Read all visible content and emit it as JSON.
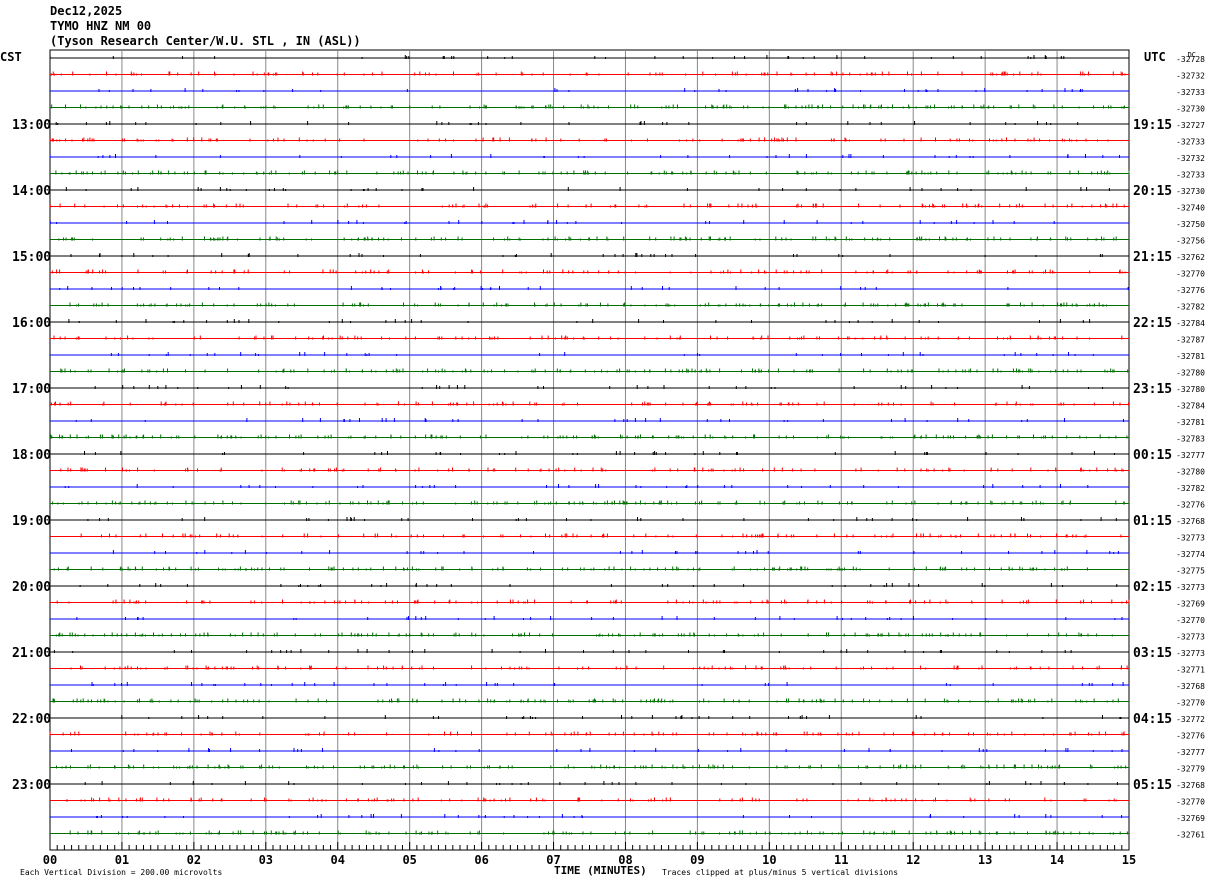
{
  "header": {
    "date": "Dec12,2025",
    "station": "TYMO HNZ NM 00",
    "location": "(Tyson Research Center/W.U. STL , IN (ASL))"
  },
  "chart_data": {
    "type": "line",
    "title": "TYMO HNZ NM 00 helicorder",
    "xlabel": "TIME (MINUTES)",
    "x_range": [
      0,
      15
    ],
    "x_ticks": [
      "00",
      "01",
      "02",
      "03",
      "04",
      "05",
      "06",
      "07",
      "08",
      "09",
      "10",
      "11",
      "12",
      "13",
      "14",
      "15"
    ],
    "left_axis_label": "CST",
    "right_axis_label": "UTC",
    "dc_label": "DC",
    "left_time_labels": [
      {
        "row": 4,
        "text": "13:00"
      },
      {
        "row": 8,
        "text": "14:00"
      },
      {
        "row": 12,
        "text": "15:00"
      },
      {
        "row": 16,
        "text": "16:00"
      },
      {
        "row": 20,
        "text": "17:00"
      },
      {
        "row": 24,
        "text": "18:00"
      },
      {
        "row": 28,
        "text": "19:00"
      },
      {
        "row": 32,
        "text": "20:00"
      },
      {
        "row": 36,
        "text": "21:00"
      },
      {
        "row": 40,
        "text": "22:00"
      },
      {
        "row": 44,
        "text": "23:00"
      }
    ],
    "right_time_labels": [
      {
        "row": 4,
        "text": "19:15"
      },
      {
        "row": 8,
        "text": "20:15"
      },
      {
        "row": 12,
        "text": "21:15"
      },
      {
        "row": 16,
        "text": "22:15"
      },
      {
        "row": 20,
        "text": "23:15"
      },
      {
        "row": 24,
        "text": "00:15"
      },
      {
        "row": 28,
        "text": "01:15"
      },
      {
        "row": 32,
        "text": "02:15"
      },
      {
        "row": 36,
        "text": "03:15"
      },
      {
        "row": 40,
        "text": "04:15"
      },
      {
        "row": 44,
        "text": "05:15"
      }
    ],
    "trace_colors": [
      "#000000",
      "#ff0000",
      "#0000ff",
      "#007000"
    ],
    "dc_offsets": [
      "-32728",
      "-32732",
      "-32733",
      "-32730",
      "-32727",
      "-32733",
      "-32732",
      "-32733",
      "-32730",
      "-32740",
      "-32750",
      "-32756",
      "-32762",
      "-32770",
      "-32776",
      "-32782",
      "-32784",
      "-32787",
      "-32781",
      "-32780",
      "-32780",
      "-32784",
      "-32781",
      "-32783",
      "-32777",
      "-32780",
      "-32782",
      "-32776",
      "-32768",
      "-32773",
      "-32774",
      "-32775",
      "-32773",
      "-32769",
      "-32770",
      "-32773",
      "-32773",
      "-32771",
      "-32768",
      "-32770",
      "-32772",
      "-32776",
      "-32777",
      "-32779",
      "-32768",
      "-32770",
      "-32769",
      "-32761"
    ],
    "scale_note": "Each Vertical Division =  200.00 microvolts",
    "clip_note": "Traces clipped at plus/minus 5 vertical divisions"
  }
}
